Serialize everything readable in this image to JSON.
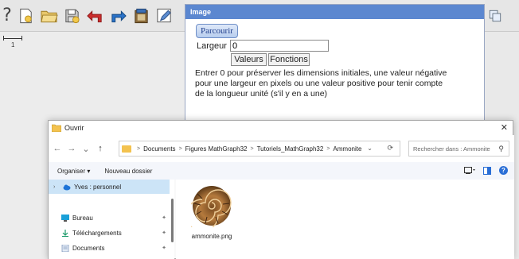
{
  "toolbar": {
    "help_glyph": "?",
    "icons": [
      "help-icon",
      "new-figure-icon",
      "open-folder-icon",
      "save-disk-icon",
      "undo-arrow-icon",
      "redo-arrow-icon",
      "book-icon",
      "pencil-icon"
    ]
  },
  "toolbar_right": {
    "icons": [
      "copy-windows-icon"
    ]
  },
  "canvas": {
    "unit_label": "1"
  },
  "image_dialog": {
    "title": "Image",
    "browse_label": "Parcourir",
    "width_label": "Largeur :",
    "width_value": "0",
    "values_label": "Valeurs",
    "functions_label": "Fonctions",
    "help_text": "Entrer 0 pour préserver les dimensions initiales, une valeur négative pour une largeur en pixels ou une valeur positive pour tenir compte de la longueur unité (s'il y en a une)"
  },
  "file_dialog": {
    "title": "Ouvrir",
    "close_glyph": "✕",
    "nav": {
      "back": "←",
      "forward": "→",
      "history": "⌄",
      "up": "↑"
    },
    "breadcrumb": [
      "Documents",
      "Figures MathGraph32",
      "Tutoriels_MathGraph32",
      "Ammonite"
    ],
    "breadcrumb_sep": ">",
    "search_placeholder": "Rechercher dans : Ammonite",
    "organize_label": "Organiser ▾",
    "new_folder_label": "Nouveau dossier",
    "help_glyph": "?",
    "sidebar": [
      {
        "label": "Yves : personnel",
        "icon": "cloud-icon",
        "selected": true
      },
      {
        "label": "Bureau",
        "icon": "desktop-icon",
        "pinned": true
      },
      {
        "label": "Téléchargements",
        "icon": "download-icon",
        "pinned": true
      },
      {
        "label": "Documents",
        "icon": "documents-icon",
        "pinned": true
      }
    ],
    "files": [
      {
        "name": "ammonite.png",
        "icon": "ammonite-image-icon"
      }
    ]
  },
  "colors": {
    "accent": "#5b87d0",
    "folder": "#f3c24f",
    "selection": "#cce4f7",
    "help": "#2b6fd6"
  }
}
